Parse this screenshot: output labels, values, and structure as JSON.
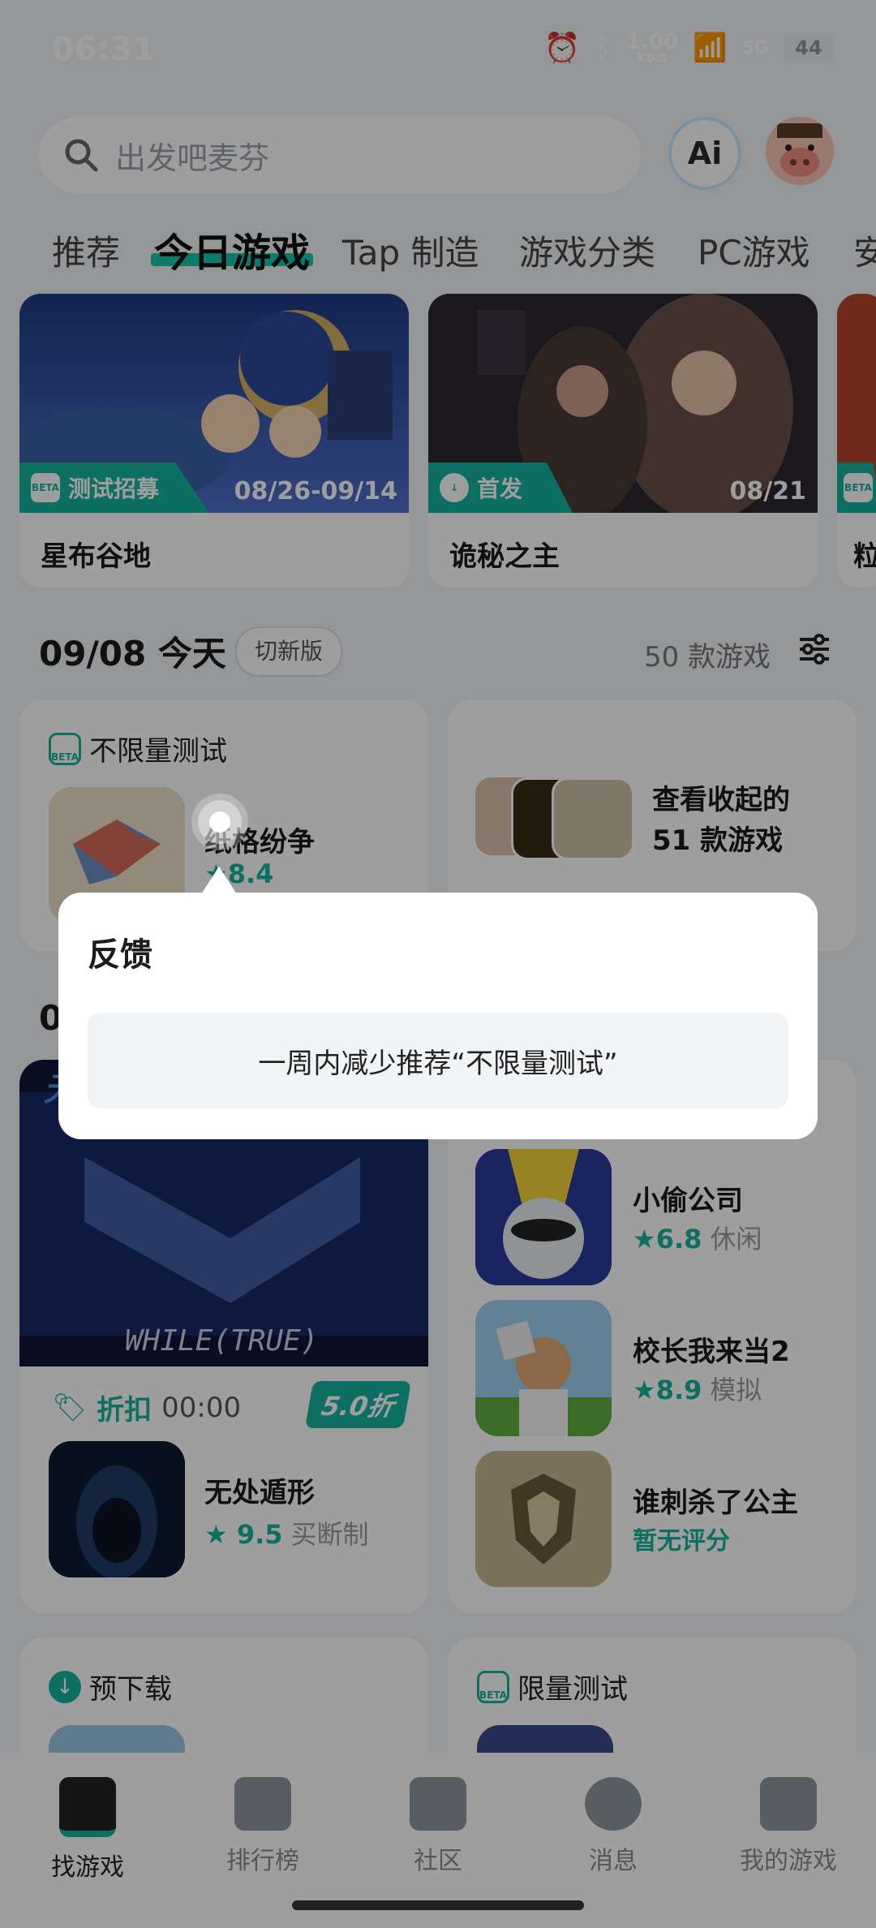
{
  "status_bar": {
    "time": "06:31",
    "net_speed": "1.00",
    "net_unit": "KB/S",
    "network": "5G",
    "battery": "44"
  },
  "search": {
    "placeholder": "出发吧麦芬"
  },
  "ai_button": {
    "label": "Ai"
  },
  "tabs": [
    "推荐",
    "今日游戏",
    "Tap 制造",
    "游戏分类",
    "PC游戏",
    "安"
  ],
  "active_tab": "今日游戏",
  "featured": [
    {
      "title": "星布谷地",
      "badge": "测试招募",
      "date": "08/26-09/14"
    },
    {
      "title": "诡秘之主",
      "badge": "首发",
      "date": "08/21"
    },
    {
      "title": "粒",
      "badge": "BETA",
      "date": ""
    }
  ],
  "date_row": {
    "date": "09/08 今天",
    "chip": "切新版",
    "count": "50 款游戏"
  },
  "unlimited_card": {
    "section": "不限量测试",
    "game": "纸格纷争",
    "rating": "8.4"
  },
  "collapsed_card": {
    "text_line1": "查看收起的",
    "text_line2": "51 款游戏"
  },
  "discount_card": {
    "section_partial": "0",
    "badge": "折扣",
    "time": "00:00",
    "discount": "5.0折",
    "game": "无处遁形",
    "rating": "9.5",
    "category": "买断制",
    "banner_text": "WHILE(TRUE)",
    "banner_top": "无"
  },
  "right_list": [
    {
      "name": "小偷公司",
      "rating": "6.8",
      "category": "休闲"
    },
    {
      "name": "校长我来当2",
      "rating": "8.9",
      "category": "模拟"
    },
    {
      "name": "谁刺杀了公主",
      "rating": "暂无评分",
      "category": ""
    }
  ],
  "bottom_sections": [
    {
      "label": "预下载"
    },
    {
      "label": "限量测试"
    }
  ],
  "nav": [
    "找游戏",
    "排行榜",
    "社区",
    "消息",
    "我的游戏"
  ],
  "popup": {
    "title": "反馈",
    "option": "一周内减少推荐“不限量测试”"
  },
  "colors": {
    "accent": "#14b39f",
    "overlay": "rgba(0,0,0,0.38)"
  }
}
